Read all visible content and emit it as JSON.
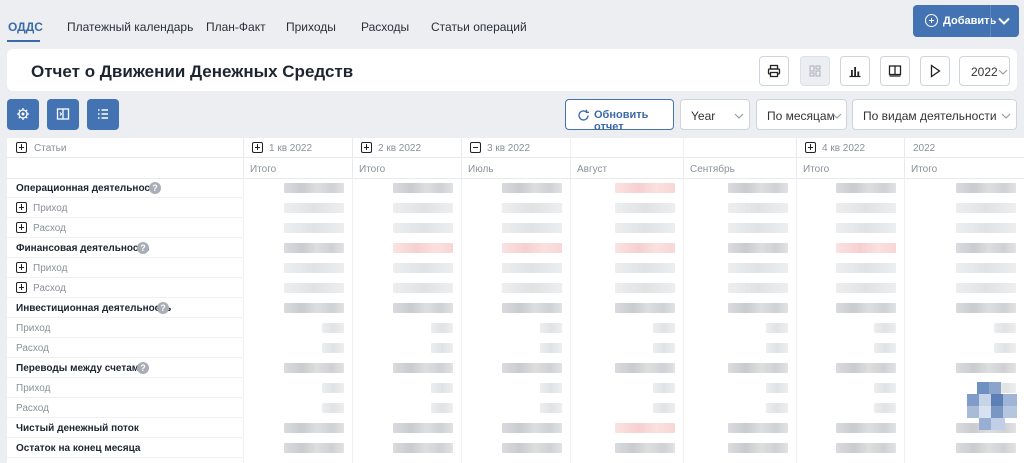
{
  "nav": {
    "tabs": [
      "ОДДС",
      "Платежный календарь",
      "План-Факт",
      "Приходы",
      "Расходы",
      "Статьи операций"
    ],
    "add_label": "Добавить"
  },
  "header": {
    "title": "Отчет о Движении Денежных Средств",
    "year": "2022",
    "icons": [
      "printer-icon",
      "dashboard-icon",
      "bar-chart-icon",
      "book-icon",
      "play-icon"
    ]
  },
  "toolbar": {
    "refresh_label": "Обновить отчет",
    "period_value": "Year",
    "grouping_value": "По месяцам",
    "activity_value": "По видам деятельности",
    "icons": [
      "settings-icon",
      "export-icon",
      "list-icon"
    ]
  },
  "table": {
    "articles_label": "Статьи",
    "columns": [
      {
        "group": "1 кв 2022",
        "expand": "plus",
        "sub": "Итого"
      },
      {
        "group": "2 кв 2022",
        "expand": "plus",
        "sub": "Итого"
      },
      {
        "group": "3 кв 2022",
        "expand": "minus",
        "sub": "Июль"
      },
      {
        "group": "",
        "expand": "",
        "sub": "Август"
      },
      {
        "group": "",
        "expand": "",
        "sub": "Сентябрь"
      },
      {
        "group": "4 кв 2022",
        "expand": "plus",
        "sub": "Итого"
      },
      {
        "group": "2022",
        "expand": "",
        "sub": "Итого"
      }
    ],
    "rows": [
      {
        "label": "Операционная деятельность",
        "kind": "bold",
        "help": "?"
      },
      {
        "label": "Приход",
        "kind": "sub",
        "expand": "plus"
      },
      {
        "label": "Расход",
        "kind": "sub",
        "expand": "plus"
      },
      {
        "label": "Финансовая деятельность",
        "kind": "bold",
        "help": "?"
      },
      {
        "label": "Приход",
        "kind": "sub",
        "expand": "plus"
      },
      {
        "label": "Расход",
        "kind": "sub",
        "expand": "plus"
      },
      {
        "label": "Инвестиционная деятельность",
        "kind": "bold",
        "help": "?"
      },
      {
        "label": "Приход",
        "kind": "sub"
      },
      {
        "label": "Расход",
        "kind": "sub"
      },
      {
        "label": "Переводы между счетами",
        "kind": "bold",
        "help": "?"
      },
      {
        "label": "Приход",
        "kind": "sub"
      },
      {
        "label": "Расход",
        "kind": "sub"
      },
      {
        "label": "Чистый денежный поток",
        "kind": "bold"
      },
      {
        "label": "Остаток на конец месяца",
        "kind": "bold"
      }
    ]
  }
}
